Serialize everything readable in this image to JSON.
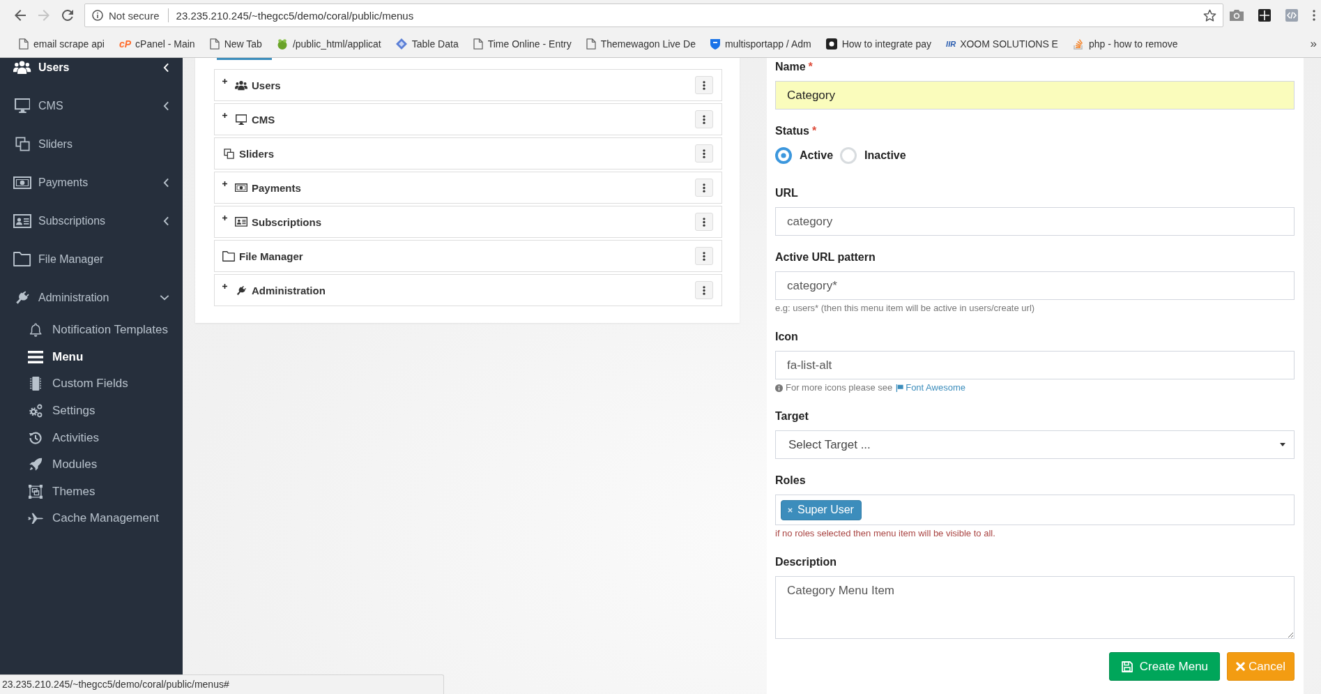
{
  "nav_buttons": {
    "back": {
      "disabled": false
    },
    "forward": {
      "disabled": true
    }
  },
  "address_bar": {
    "security": "Not secure",
    "url": "23.235.210.245/~thegcc5/demo/coral/public/menus"
  },
  "bookmarks": [
    {
      "label": "email scrape api"
    },
    {
      "label": "cPanel - Main",
      "logo_text": "cP"
    },
    {
      "label": "New Tab"
    },
    {
      "label": "/public_html/applicat"
    },
    {
      "label": "Table Data"
    },
    {
      "label": "Time Online - Entry"
    },
    {
      "label": "Themewagon Live De"
    },
    {
      "label": "multisportapp / Adm"
    },
    {
      "label": "How to integrate pay"
    },
    {
      "label": "XOOM SOLUTIONS E",
      "logo_text": "IIR"
    },
    {
      "label": "php - how to remove"
    }
  ],
  "bookmarks_overflow": "»",
  "sidebar": {
    "items": [
      {
        "label": "Users",
        "kind": "group",
        "expanded": false,
        "highlighted": true
      },
      {
        "label": "CMS",
        "kind": "group",
        "expanded": false,
        "highlighted": false
      },
      {
        "label": "Sliders",
        "kind": "link",
        "highlighted": false
      },
      {
        "label": "Payments",
        "kind": "group",
        "expanded": false,
        "highlighted": false
      },
      {
        "label": "Subscriptions",
        "kind": "group",
        "expanded": false,
        "highlighted": false
      },
      {
        "label": "File Manager",
        "kind": "link",
        "highlighted": false
      },
      {
        "label": "Administration",
        "kind": "group",
        "expanded": true,
        "highlighted": false,
        "children": [
          {
            "label": "Notification Templates",
            "selected": false
          },
          {
            "label": "Menu",
            "selected": true
          },
          {
            "label": "Custom Fields",
            "selected": false
          },
          {
            "label": "Settings",
            "selected": false
          },
          {
            "label": "Activities",
            "selected": false
          },
          {
            "label": "Modules",
            "selected": false
          },
          {
            "label": "Themes",
            "selected": false
          },
          {
            "label": "Cache Management",
            "selected": false
          }
        ]
      }
    ]
  },
  "menu_tree": {
    "items": [
      {
        "label": "Users",
        "has_children": true
      },
      {
        "label": "CMS",
        "has_children": true
      },
      {
        "label": "Sliders",
        "has_children": false
      },
      {
        "label": "Payments",
        "has_children": true
      },
      {
        "label": "Subscriptions",
        "has_children": true
      },
      {
        "label": "File Manager",
        "has_children": false
      },
      {
        "label": "Administration",
        "has_children": true
      }
    ]
  },
  "form": {
    "fields": [
      {
        "kind": "text",
        "label": "Name",
        "required_mark": "*",
        "value": "Category",
        "autofilled": true
      },
      {
        "kind": "radio",
        "label": "Status",
        "required_mark": "*",
        "options": [
          {
            "label": "Active",
            "selected": true
          },
          {
            "label": "Inactive",
            "selected": false
          }
        ]
      },
      {
        "kind": "text",
        "label": "URL",
        "value": "category",
        "autofilled": false
      },
      {
        "kind": "text",
        "label": "Active URL pattern",
        "value": "category*",
        "autofilled": false,
        "help": {
          "kind": "plain",
          "text": "e.g: users* (then this menu item will be active in users/create url)"
        }
      },
      {
        "kind": "text",
        "label": "Icon",
        "value": "fa-list-alt",
        "autofilled": false,
        "help": {
          "kind": "info",
          "text": "For more icons please see",
          "link": "Font Awesome"
        }
      },
      {
        "kind": "select",
        "label": "Target",
        "placeholder": "Select Target ..."
      },
      {
        "kind": "tags",
        "label": "Roles",
        "tags": [
          "Super User"
        ],
        "help": {
          "kind": "error",
          "text": "if no roles selected then menu item will be visible to all."
        }
      },
      {
        "kind": "textarea",
        "label": "Description",
        "value": "Category Menu Item"
      }
    ],
    "buttons": [
      {
        "label": "Create Menu",
        "kind": "primary"
      },
      {
        "label": "Cancel",
        "kind": "cancel"
      }
    ]
  },
  "status_url": "23.235.210.245/~thegcc5/demo/coral/public/menus#"
}
